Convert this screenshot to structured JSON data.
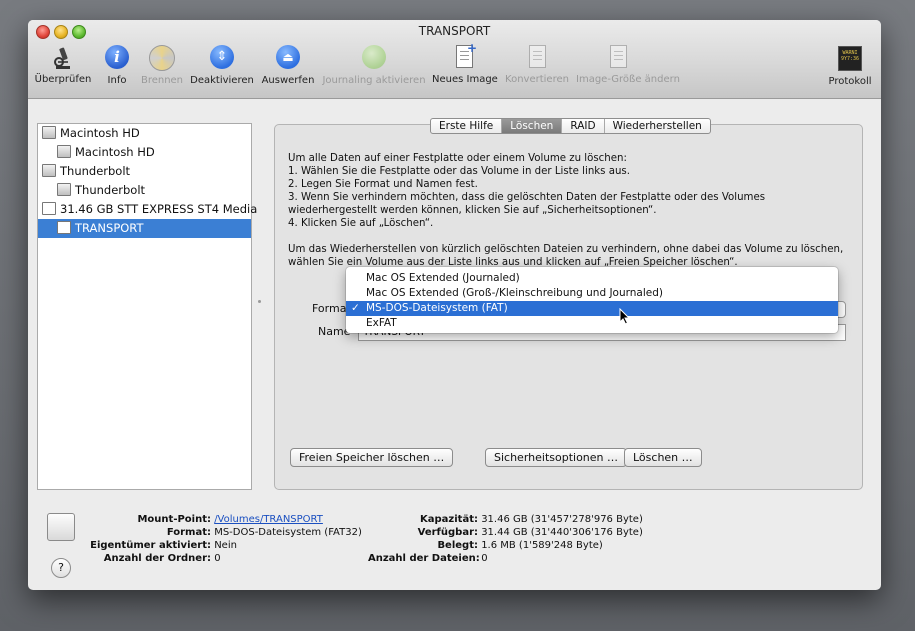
{
  "window": {
    "title": "TRANSPORT"
  },
  "toolbar": {
    "items": [
      {
        "label": "Überprüfen",
        "icon": "microscope-icon"
      },
      {
        "label": "Info",
        "icon": "info-icon"
      },
      {
        "label": "Brennen",
        "icon": "burn-icon"
      },
      {
        "label": "Deaktivieren",
        "icon": "unmount-icon"
      },
      {
        "label": "Auswerfen",
        "icon": "eject-icon"
      },
      {
        "label": "Journaling aktivieren",
        "icon": "journaling-icon"
      },
      {
        "label": "Neues Image",
        "icon": "new-image-icon"
      },
      {
        "label": "Konvertieren",
        "icon": "convert-icon"
      },
      {
        "label": "Image-Größe ändern",
        "icon": "resize-image-icon"
      },
      {
        "label": "Protokoll",
        "icon": "log-icon"
      }
    ],
    "log_icon_text": [
      "WARNI",
      "9Y7:36"
    ]
  },
  "sidebar": {
    "items": [
      {
        "label": "Macintosh HD"
      },
      {
        "label": "Macintosh HD"
      },
      {
        "label": "Thunderbolt"
      },
      {
        "label": "Thunderbolt"
      },
      {
        "label": "31.46 GB STT EXPRESS ST4 Media"
      },
      {
        "label": "TRANSPORT"
      }
    ]
  },
  "tabs": [
    "Erste Hilfe",
    "Löschen",
    "RAID",
    "Wiederherstellen"
  ],
  "instructions": {
    "intro": "Um alle Daten auf einer Festplatte oder einem Volume zu löschen:",
    "s1": "1.    Wählen Sie die Festplatte oder das Volume in der Liste links aus.",
    "s2": "2.    Legen Sie Format und Namen fest.",
    "s3": "3.    Wenn Sie verhindern möchten, dass die gelöschten Daten der Festplatte oder des Volumes",
    "s3b": "wiederhergestellt werden können, klicken Sie auf „Sicherheitsoptionen“.",
    "s4": "4.    Klicken Sie auf „Löschen“.",
    "p2a": "Um das Wiederherstellen von kürzlich gelöschten Dateien zu verhindern, ohne dabei das Volume zu löschen,",
    "p2b": "wählen Sie ein Volume aus der Liste links aus und klicken auf „Freien Speicher löschen“."
  },
  "form": {
    "format_label": "Format",
    "name_label": "Name",
    "name_value": "TRANSPORT"
  },
  "format_menu": {
    "options": [
      "Mac OS Extended (Journaled)",
      "Mac OS Extended (Groß-/Kleinschreibung und Journaled)",
      "MS-DOS-Dateisystem (FAT)",
      "ExFAT"
    ],
    "selected_index": 2,
    "check": "✓"
  },
  "buttons": {
    "free_space": "Freien Speicher löschen …",
    "security": "Sicherheitsoptionen …",
    "erase": "Löschen …"
  },
  "info": {
    "mount_point_label": "Mount-Point:",
    "mount_point_value": "/Volumes/TRANSPORT",
    "format_label": "Format:",
    "format_value": "MS-DOS-Dateisystem (FAT32)",
    "owners_label": "Eigentümer aktiviert:",
    "owners_value": "Nein",
    "folders_label": "Anzahl der Ordner:",
    "folders_value": "0",
    "capacity_label": "Kapazität:",
    "capacity_value": "31.46 GB (31'457'278'976 Byte)",
    "available_label": "Verfügbar:",
    "available_value": "31.44 GB (31'440'306'176 Byte)",
    "used_label": "Belegt:",
    "used_value": "1.6 MB (1'589'248 Byte)",
    "files_label": "Anzahl der Dateien:",
    "files_value": "0"
  },
  "help_label": "?"
}
